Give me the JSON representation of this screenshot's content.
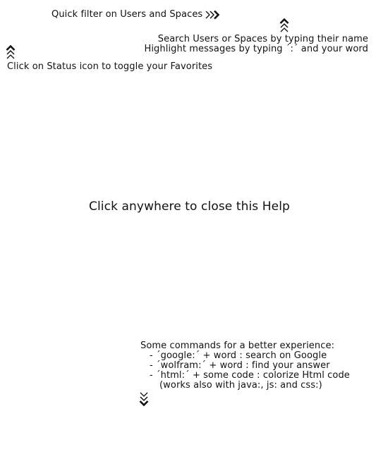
{
  "help": {
    "quick_filter": "Quick filter on Users and Spaces",
    "search_hint": "Search Users or Spaces by typing their name",
    "highlight_hint": "Highlight messages by typing ´:´ and your word",
    "status_hint": "Click on Status icon to toggle your Favorites",
    "close_hint": "Click anywhere to close this Help",
    "commands": {
      "title": "Some commands for a better experience:",
      "items": [
        "- ´google:´ + word : search on Google",
        "- ´wolfram:´ + word : find your answer",
        "- ´html:´ + some code : colorize Html code"
      ],
      "note": "(works also with java:, js: and css:)"
    }
  },
  "icons": {
    "right": "triple-chevron-right-icon",
    "up": "triple-chevron-up-icon",
    "down": "triple-chevron-down-icon"
  },
  "colors": {
    "text": "#111111",
    "background": "#ffffff"
  }
}
